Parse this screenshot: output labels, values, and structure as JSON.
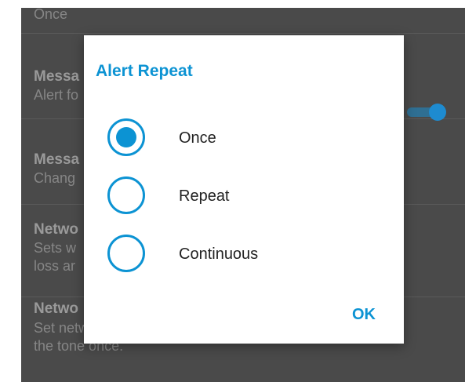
{
  "colors": {
    "accent": "#0c93d3",
    "background_overlay": "#4a4a4a",
    "dialog_background": "#ffffff",
    "dimmed_text": "#9a9a9a"
  },
  "settings": {
    "rows": [
      {
        "title": "",
        "summary": "Once"
      },
      {
        "title": "Messa",
        "summary": "Alert fo"
      },
      {
        "title": "Messa",
        "summary": "Chang"
      },
      {
        "title": "Netwo",
        "summary": "Sets w\nloss ar"
      },
      {
        "title": "Netwo",
        "summary": "Set network loss tone repeat timer. No repeat plays the tone once."
      }
    ],
    "toggle_state": "on"
  },
  "dialog": {
    "title": "Alert Repeat",
    "options": [
      {
        "label": "Once",
        "selected": true
      },
      {
        "label": "Repeat",
        "selected": false
      },
      {
        "label": "Continuous",
        "selected": false
      }
    ],
    "ok_label": "OK"
  }
}
